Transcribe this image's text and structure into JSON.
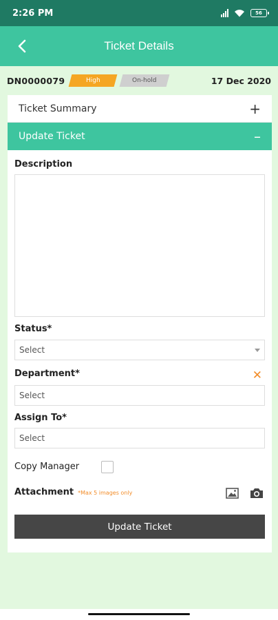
{
  "status_bar": {
    "time": "2:26 PM",
    "battery": "56"
  },
  "app_bar": {
    "title": "Ticket Details",
    "back_icon": "chevron-left-icon"
  },
  "ticket": {
    "id": "DN0000079",
    "priority": "High",
    "state": "On-hold",
    "date": "17 Dec 2020"
  },
  "colors": {
    "primary": "#3ec59f",
    "status_bar": "#1f7a63",
    "priority": "#f5a623",
    "accent": "#f28c28",
    "button": "#464646"
  },
  "sections": {
    "summary": "Ticket Summary",
    "summary_toggle": "+",
    "update": "Update Ticket",
    "update_toggle": "–"
  },
  "form": {
    "description_label": "Description",
    "description_value": "",
    "status_label": "Status*",
    "status_value": "Select",
    "department_label": "Department*",
    "department_value": "Select",
    "assign_label": "Assign To*",
    "assign_value": "Select",
    "copy_manager_label": "Copy Manager",
    "attachment_label": "Attachment",
    "attachment_note": "*Max 5 images only"
  },
  "submit_label": "Update Ticket"
}
